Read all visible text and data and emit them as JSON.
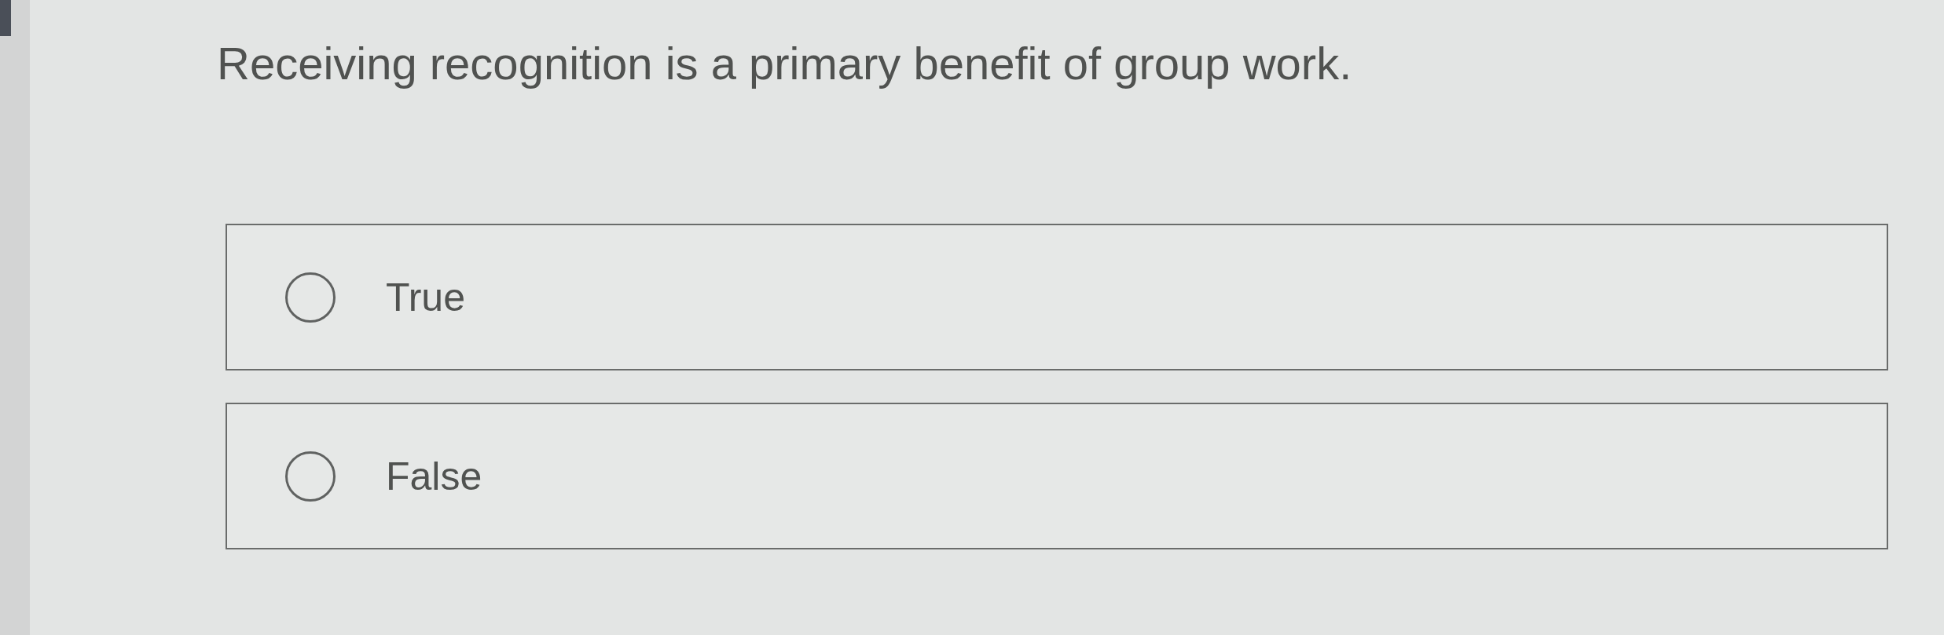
{
  "question": "Receiving recognition is a primary benefit of group work.",
  "options": [
    {
      "label": "True",
      "selected": false
    },
    {
      "label": "False",
      "selected": false
    }
  ]
}
